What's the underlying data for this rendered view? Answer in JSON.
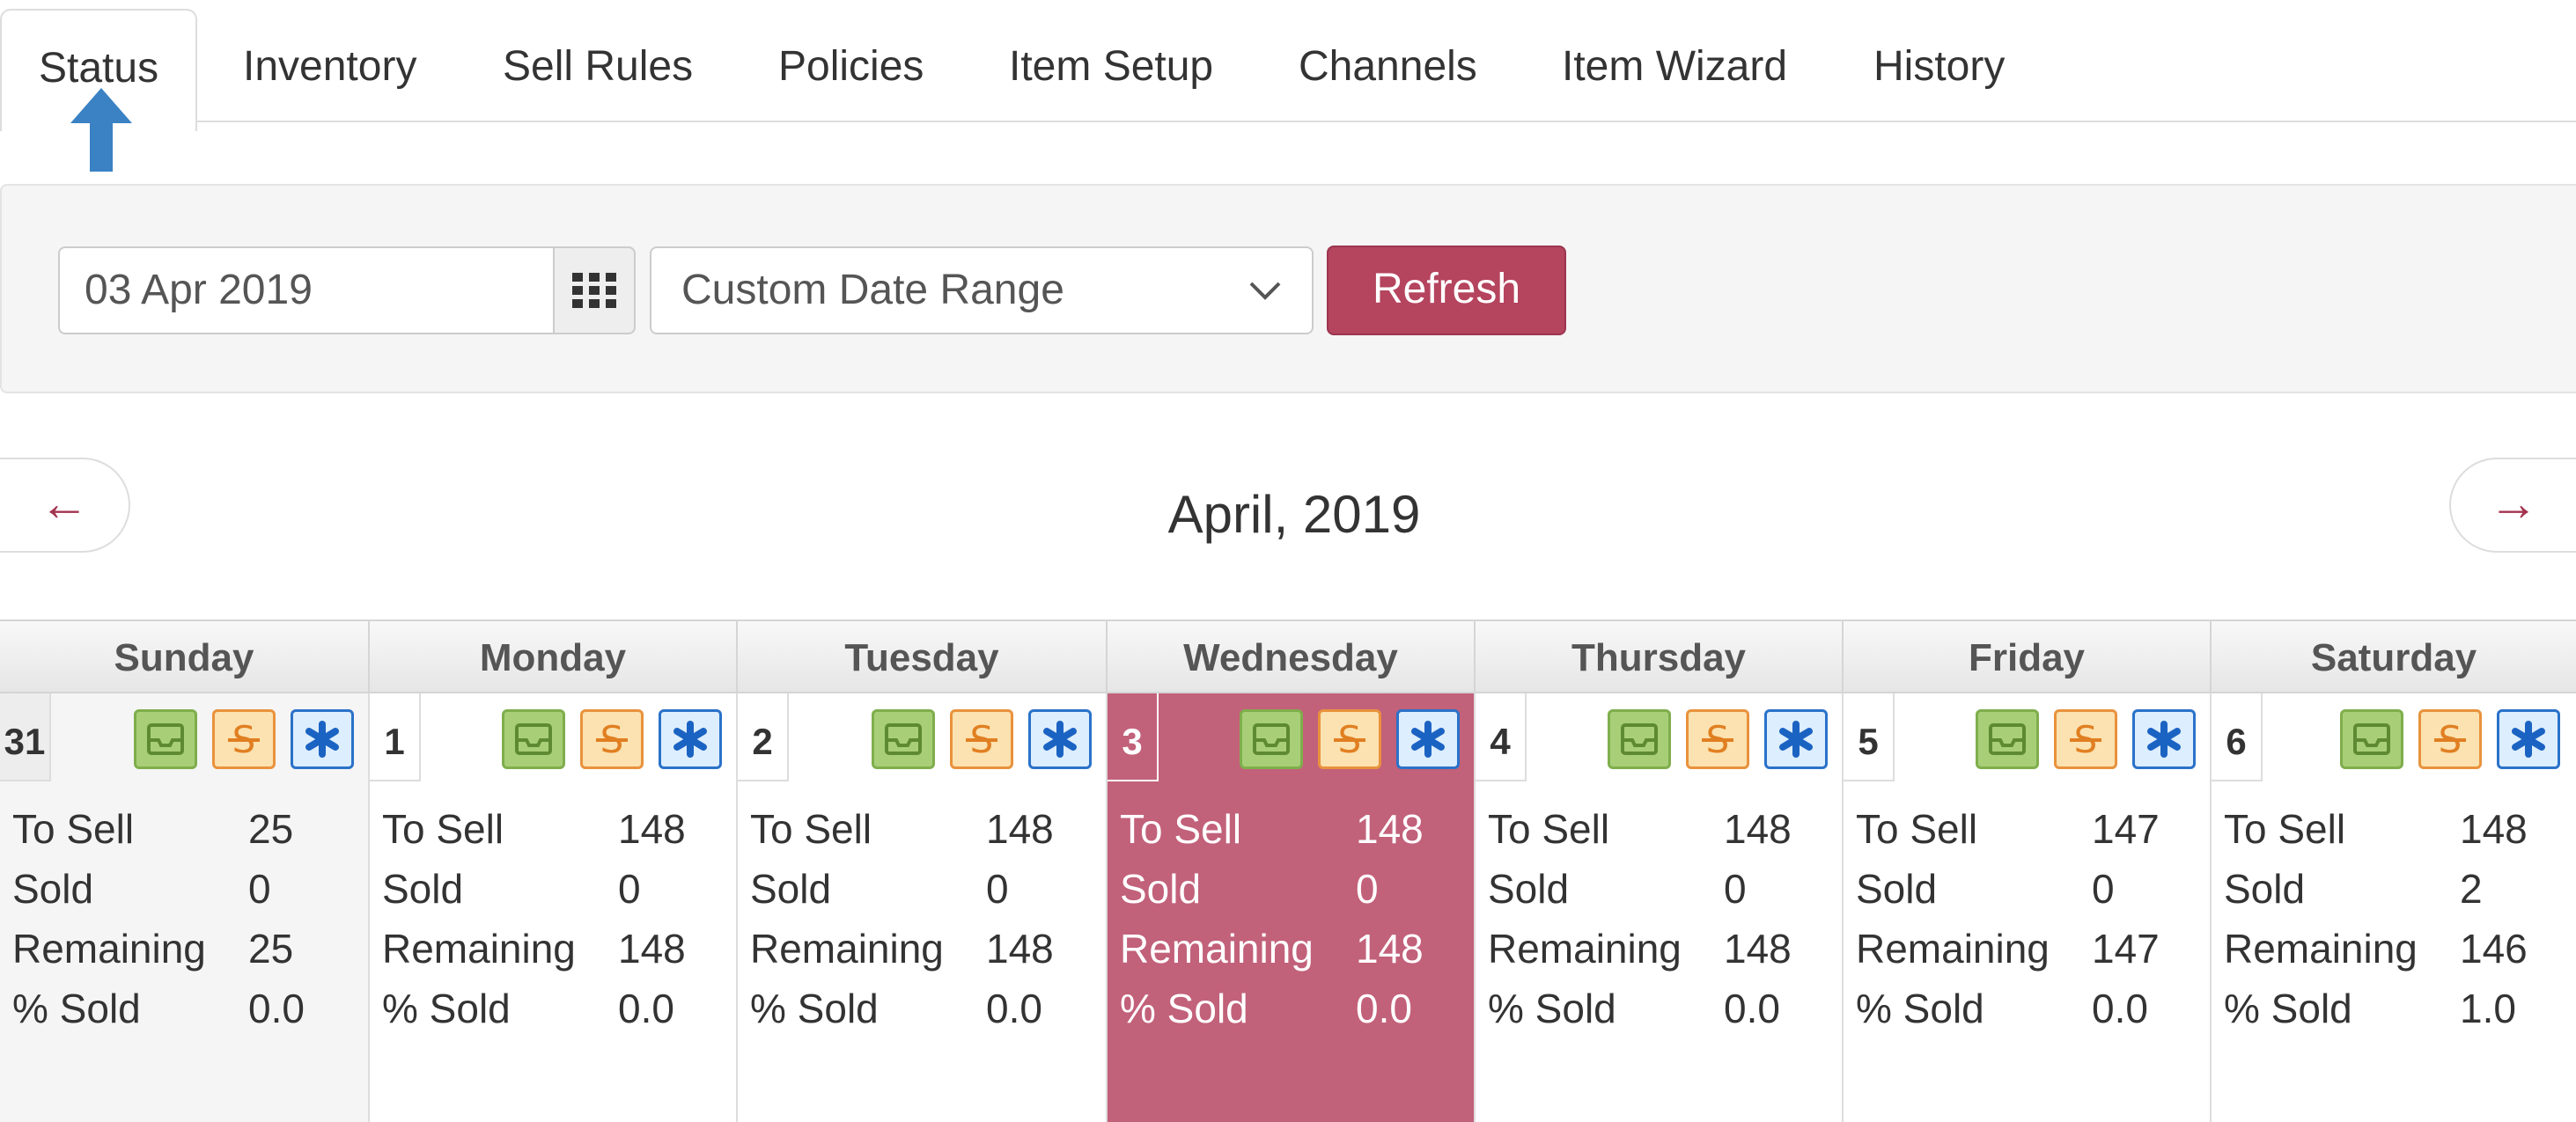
{
  "tabs": [
    {
      "label": "Status",
      "active": true
    },
    {
      "label": "Inventory"
    },
    {
      "label": "Sell Rules"
    },
    {
      "label": "Policies"
    },
    {
      "label": "Item Setup"
    },
    {
      "label": "Channels"
    },
    {
      "label": "Item Wizard"
    },
    {
      "label": "History"
    }
  ],
  "toolbar": {
    "date_value": "03 Apr 2019",
    "range_selected": "Custom Date Range",
    "refresh_label": "Refresh"
  },
  "nav": {
    "prev": "←",
    "next": "→"
  },
  "calendar": {
    "month_title": "April, 2019",
    "weekdays": [
      "Sunday",
      "Monday",
      "Tuesday",
      "Wednesday",
      "Thursday",
      "Friday",
      "Saturday"
    ],
    "stat_labels": [
      "To Sell",
      "Sold",
      "Remaining",
      "% Sold"
    ],
    "days": [
      {
        "num": "31",
        "to_sell": "25",
        "sold": "0",
        "remaining": "25",
        "pct_sold": "0.0"
      },
      {
        "num": "1",
        "to_sell": "148",
        "sold": "0",
        "remaining": "148",
        "pct_sold": "0.0"
      },
      {
        "num": "2",
        "to_sell": "148",
        "sold": "0",
        "remaining": "148",
        "pct_sold": "0.0"
      },
      {
        "num": "3",
        "to_sell": "148",
        "sold": "0",
        "remaining": "148",
        "pct_sold": "0.0"
      },
      {
        "num": "4",
        "to_sell": "148",
        "sold": "0",
        "remaining": "148",
        "pct_sold": "0.0"
      },
      {
        "num": "5",
        "to_sell": "147",
        "sold": "0",
        "remaining": "147",
        "pct_sold": "0.0"
      },
      {
        "num": "6",
        "to_sell": "148",
        "sold": "2",
        "remaining": "146",
        "pct_sold": "1.0"
      }
    ]
  },
  "colors": {
    "accent": "#b5445e",
    "today_bg": "#c2617a",
    "inventory_icon": "#a8cf78",
    "rule_icon": "#e9923c",
    "policy_icon": "#2a72c9",
    "arrow": "#3a82c4"
  },
  "icons": {
    "inventory": "inbox-tray-icon",
    "rules": "strikethrough-s-icon",
    "policies": "asterisk-icon",
    "calendar": "grid-calendar-icon",
    "dropdown": "chevron-down-icon"
  }
}
